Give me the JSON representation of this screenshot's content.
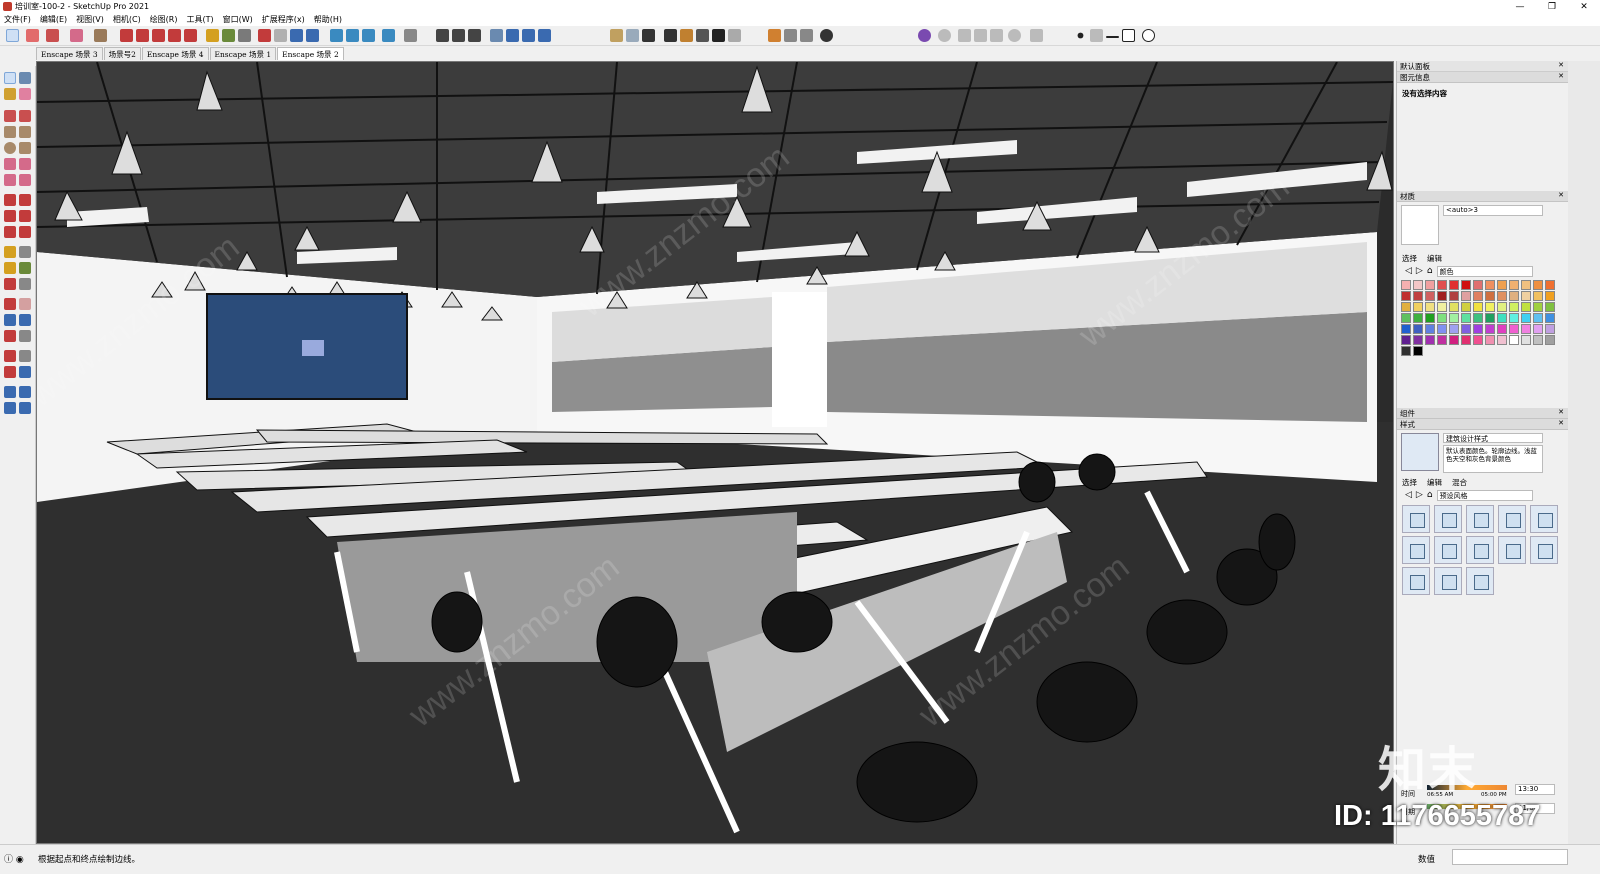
{
  "window": {
    "title": "培训室-100-2 - SketchUp Pro 2021",
    "controls": [
      "—",
      "❐",
      "✕"
    ]
  },
  "menu": [
    "文件(F)",
    "编辑(E)",
    "视图(V)",
    "相机(C)",
    "绘图(R)",
    "工具(T)",
    "窗口(W)",
    "扩展程序(x)",
    "帮助(H)"
  ],
  "scene_tabs": [
    "Enscape 场景 3",
    "场景号2",
    "Enscape 场景 4",
    "Enscape 场景 1",
    "Enscape 场景 2"
  ],
  "active_scene_index": 4,
  "panel": {
    "title": "默认面板",
    "entity_info": {
      "header": "图元信息",
      "empty_text": "没有选择内容"
    },
    "materials": {
      "header": "材质",
      "material_name": "<auto>3",
      "tabs": [
        "选择",
        "编辑"
      ],
      "library": "颜色"
    },
    "components": {
      "header": "组件"
    },
    "styles": {
      "header": "样式",
      "style_name": "建筑设计样式",
      "style_desc": "默认表面颜色。轮廓边线。浅蓝色天空和灰色背景颜色",
      "tabs": [
        "选择",
        "编辑",
        "混合"
      ],
      "library": "预设风格"
    },
    "shadows": {
      "time_label": "时间",
      "date_label": "日期",
      "time_start": "06:55 AM",
      "time_end": "05:00 PM",
      "time_value": "13:30",
      "date_value": "11/08"
    }
  },
  "status": {
    "hint": "根据起点和终点绘制边线。",
    "measure_label": "数值"
  },
  "watermark": {
    "logo": "知末",
    "id": "ID: 1176655787",
    "site": "www.znzmo.com"
  },
  "colors": {
    "ceiling_dark": "#3a3a3a",
    "floor": "#2a2a2a",
    "wall": "#f4f4f4",
    "screen": "#2a4a7a"
  }
}
